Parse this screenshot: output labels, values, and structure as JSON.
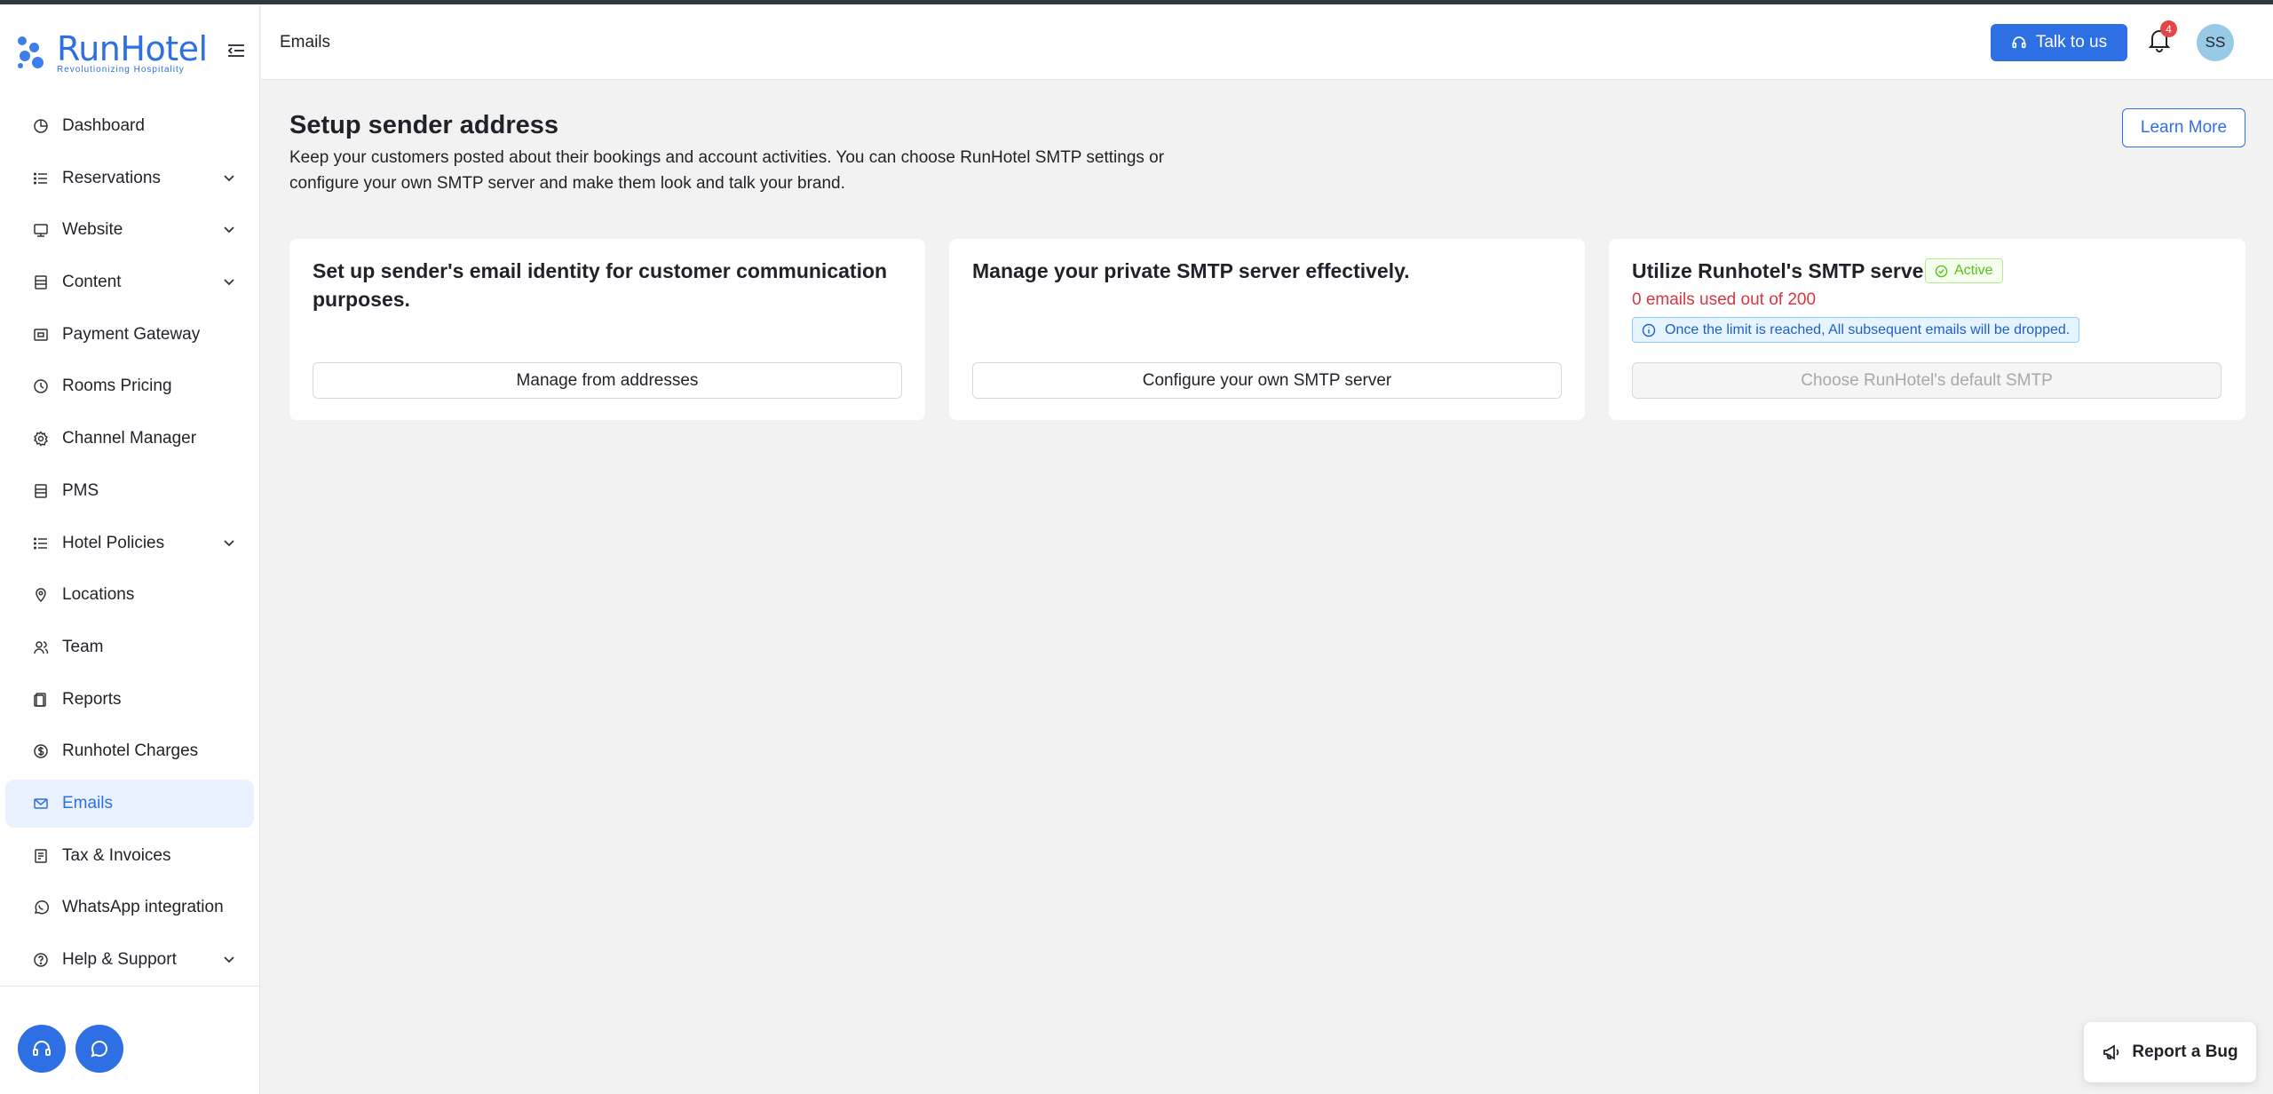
{
  "brand": {
    "name": "RunHotel",
    "tagline": "Revolutionizing Hospitality",
    "accent": "#2f6fe4"
  },
  "header": {
    "breadcrumb": "Emails",
    "talk_label": "Talk to us",
    "notification_count": "4",
    "avatar_initials": "SS"
  },
  "sidebar": {
    "items": [
      {
        "label": "Dashboard",
        "icon": "pie-chart-icon"
      },
      {
        "label": "Reservations",
        "icon": "list-icon",
        "expandable": true
      },
      {
        "label": "Website",
        "icon": "monitor-icon",
        "expandable": true
      },
      {
        "label": "Content",
        "icon": "document-icon",
        "expandable": true
      },
      {
        "label": "Payment Gateway",
        "icon": "payment-icon"
      },
      {
        "label": "Rooms Pricing",
        "icon": "clock-icon"
      },
      {
        "label": "Channel Manager",
        "icon": "gear-icon"
      },
      {
        "label": "PMS",
        "icon": "document-icon"
      },
      {
        "label": "Hotel Policies",
        "icon": "list-icon",
        "expandable": true
      },
      {
        "label": "Locations",
        "icon": "map-pin-icon"
      },
      {
        "label": "Team",
        "icon": "team-icon"
      },
      {
        "label": "Reports",
        "icon": "reports-icon"
      },
      {
        "label": "Runhotel Charges",
        "icon": "dollar-icon"
      },
      {
        "label": "Emails",
        "icon": "mail-icon",
        "active": true
      },
      {
        "label": "Tax & Invoices",
        "icon": "invoice-icon"
      },
      {
        "label": "WhatsApp integration",
        "icon": "whatsapp-icon"
      },
      {
        "label": "Help & Support",
        "icon": "help-icon",
        "expandable": true
      }
    ]
  },
  "main": {
    "title": "Setup sender address",
    "description": "Keep your customers posted about their bookings and account activities. You can choose RunHotel SMTP settings or configure your own SMTP server and make them look and talk your brand.",
    "learn_more": "Learn More",
    "cards": [
      {
        "title": "Set up sender's email identity for customer communication purposes.",
        "button": "Manage from addresses"
      },
      {
        "title": "Manage your private SMTP server effectively.",
        "button": "Configure your own SMTP server"
      },
      {
        "title": "Utilize Runhotel's SMTP server",
        "status": "Active",
        "usage": "0 emails used out of 200",
        "info": "Once the limit is reached, All subsequent emails will be dropped.",
        "button": "Choose RunHotel's default SMTP",
        "button_disabled": true
      }
    ]
  },
  "report_bug": "Report a Bug"
}
